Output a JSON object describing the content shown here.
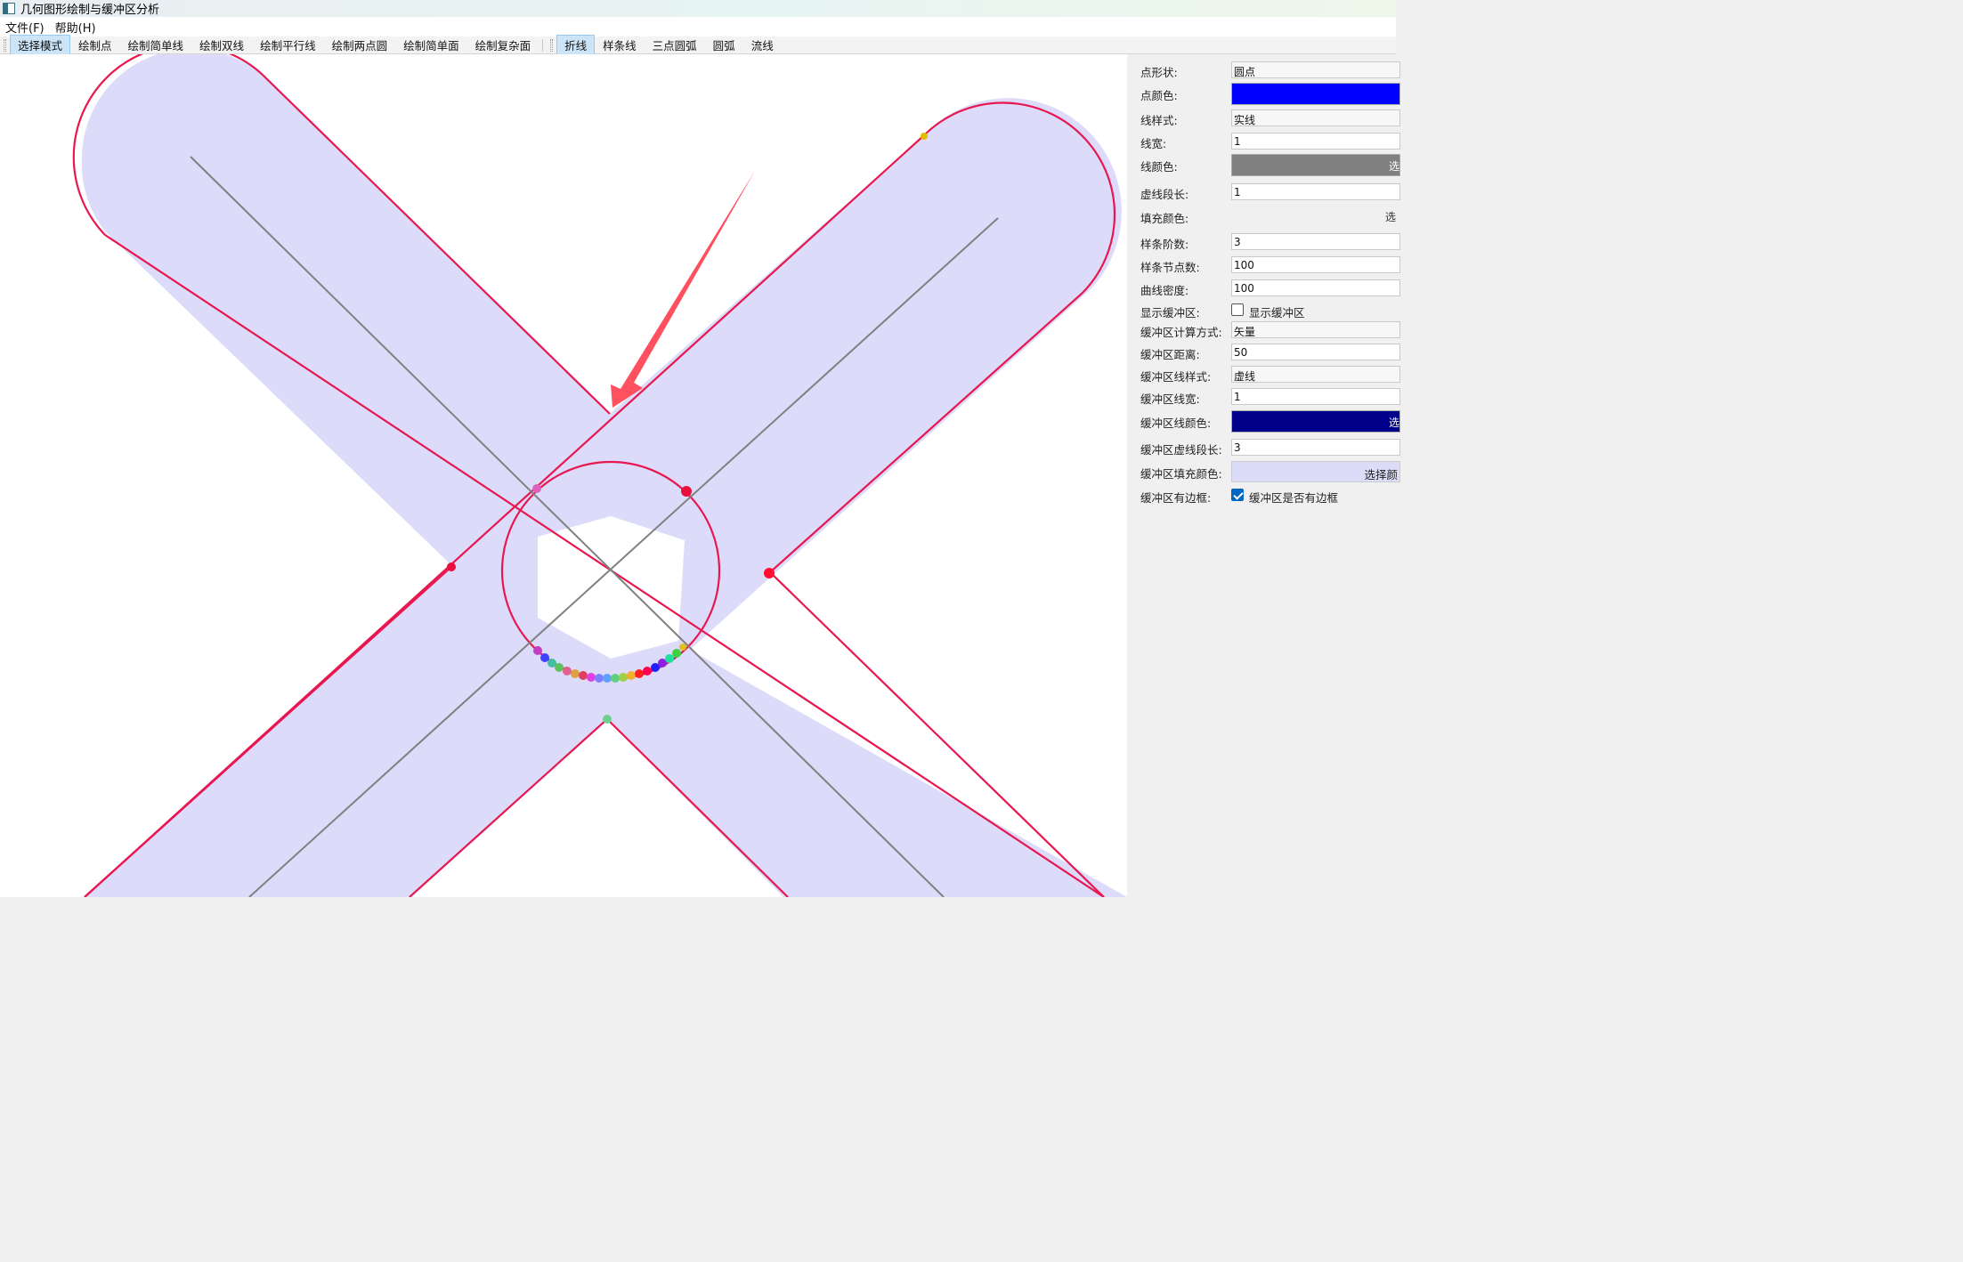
{
  "window": {
    "title": "几何图形绘制与缓冲区分析"
  },
  "menu": [
    {
      "label": "文件(F)"
    },
    {
      "label": "帮助(H)"
    }
  ],
  "toolbar": {
    "draw_tools": [
      "选择模式",
      "绘制点",
      "绘制简单线",
      "绘制双线",
      "绘制平行线",
      "绘制两点圆",
      "绘制简单面",
      "绘制复杂面"
    ],
    "line_tools": [
      "折线",
      "样条线",
      "三点圆弧",
      "圆弧",
      "流线"
    ],
    "active_draw": "选择模式",
    "active_line": "折线"
  },
  "properties": {
    "point_shape": {
      "label": "点形状:",
      "value": "圆点"
    },
    "point_color": {
      "label": "点颜色:",
      "color": "#0000ff",
      "text": ""
    },
    "line_style": {
      "label": "线样式:",
      "value": "实线"
    },
    "line_width": {
      "label": "线宽:",
      "value": "1"
    },
    "line_color": {
      "label": "线颜色:",
      "color": "#808080",
      "text": "选"
    },
    "dash_length": {
      "label": "虚线段长:",
      "value": "1"
    },
    "fill_color": {
      "label": "填充颜色:",
      "text": "选"
    },
    "spline_order": {
      "label": "样条阶数:",
      "value": "3"
    },
    "spline_knots": {
      "label": "样条节点数:",
      "value": "100"
    },
    "curve_density": {
      "label": "曲线密度:",
      "value": "100"
    },
    "show_buffer": {
      "label": "显示缓冲区:",
      "checkbox_label": "显示缓冲区",
      "checked": false
    },
    "buffer_method": {
      "label": "缓冲区计算方式:",
      "value": "矢量"
    },
    "buffer_distance": {
      "label": "缓冲区距离:",
      "value": "50"
    },
    "buffer_line_style": {
      "label": "缓冲区线样式:",
      "value": "虚线"
    },
    "buffer_line_width": {
      "label": "缓冲区线宽:",
      "value": "1"
    },
    "buffer_line_color": {
      "label": "缓冲区线颜色:",
      "color": "#00008b",
      "text": "选"
    },
    "buffer_dash_length": {
      "label": "缓冲区虚线段长:",
      "value": "3"
    },
    "buffer_fill_color": {
      "label": "缓冲区填充颜色:",
      "text": "选择颜",
      "color": "#dcdcf8"
    },
    "buffer_border": {
      "label": "缓冲区有边框:",
      "checkbox_label": "缓冲区是否有边框",
      "checked": true
    }
  },
  "colors": {
    "buffer_fill": "#dcdcfa",
    "outline": "#e8174f",
    "centerline": "#808080",
    "arrow": "#ff5060"
  }
}
